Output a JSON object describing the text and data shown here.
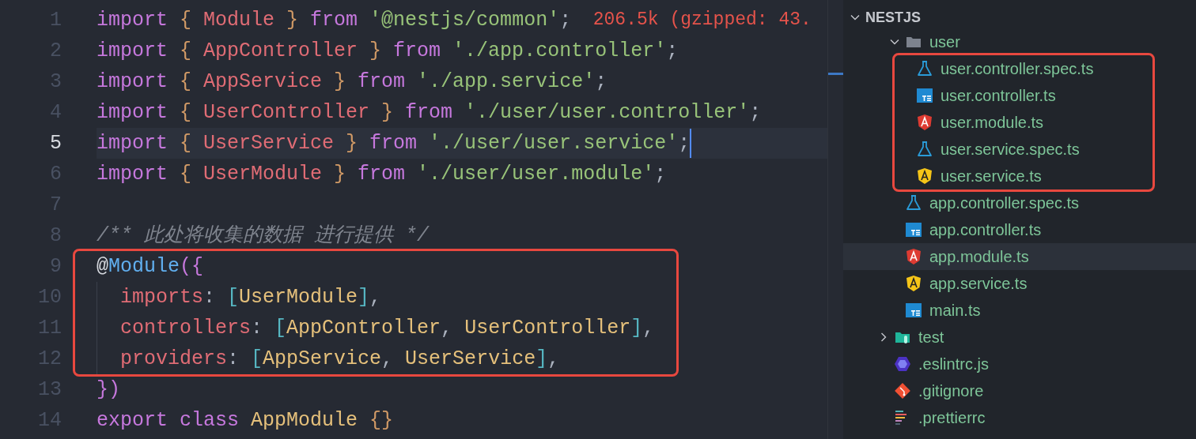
{
  "editor": {
    "lines": [
      {
        "number": "1",
        "current": false,
        "boxed": false,
        "indented": false,
        "tokens": [
          {
            "text": "import",
            "kind": "keyword"
          },
          {
            "text": " {",
            "kind": "brace"
          },
          {
            "text": " Module",
            "kind": "ident"
          },
          {
            "text": " }",
            "kind": "brace"
          },
          {
            "text": " from",
            "kind": "keyword"
          },
          {
            "text": " '@nestjs/common'",
            "kind": "string"
          },
          {
            "text": ";",
            "kind": "punct"
          },
          {
            "text": "  206.5k (gzipped: 43.",
            "kind": "hint"
          }
        ]
      },
      {
        "number": "2",
        "current": false,
        "boxed": false,
        "indented": false,
        "tokens": [
          {
            "text": "import",
            "kind": "keyword"
          },
          {
            "text": " {",
            "kind": "brace"
          },
          {
            "text": " AppController",
            "kind": "ident"
          },
          {
            "text": " }",
            "kind": "brace"
          },
          {
            "text": " from",
            "kind": "keyword"
          },
          {
            "text": " './app.controller'",
            "kind": "string"
          },
          {
            "text": ";",
            "kind": "punct"
          }
        ]
      },
      {
        "number": "3",
        "current": false,
        "boxed": false,
        "indented": false,
        "tokens": [
          {
            "text": "import",
            "kind": "keyword"
          },
          {
            "text": " {",
            "kind": "brace"
          },
          {
            "text": " AppService",
            "kind": "ident"
          },
          {
            "text": " }",
            "kind": "brace"
          },
          {
            "text": " from",
            "kind": "keyword"
          },
          {
            "text": " './app.service'",
            "kind": "string"
          },
          {
            "text": ";",
            "kind": "punct"
          }
        ]
      },
      {
        "number": "4",
        "current": false,
        "boxed": false,
        "indented": false,
        "tokens": [
          {
            "text": "import",
            "kind": "keyword"
          },
          {
            "text": " {",
            "kind": "brace"
          },
          {
            "text": " UserController",
            "kind": "ident"
          },
          {
            "text": " }",
            "kind": "brace"
          },
          {
            "text": " from",
            "kind": "keyword"
          },
          {
            "text": " './user/user.controller'",
            "kind": "string"
          },
          {
            "text": ";",
            "kind": "punct"
          }
        ]
      },
      {
        "number": "5",
        "current": true,
        "boxed": false,
        "indented": false,
        "tokens": [
          {
            "text": "import",
            "kind": "keyword"
          },
          {
            "text": " {",
            "kind": "brace"
          },
          {
            "text": " UserService",
            "kind": "ident"
          },
          {
            "text": " }",
            "kind": "brace"
          },
          {
            "text": " from",
            "kind": "keyword"
          },
          {
            "text": " './user/user.service'",
            "kind": "string"
          },
          {
            "text": ";",
            "kind": "punct"
          }
        ]
      },
      {
        "number": "6",
        "current": false,
        "boxed": false,
        "indented": false,
        "tokens": [
          {
            "text": "import",
            "kind": "keyword"
          },
          {
            "text": " {",
            "kind": "brace"
          },
          {
            "text": " UserModule",
            "kind": "ident"
          },
          {
            "text": " }",
            "kind": "brace"
          },
          {
            "text": " from",
            "kind": "keyword"
          },
          {
            "text": " './user/user.module'",
            "kind": "string"
          },
          {
            "text": ";",
            "kind": "punct"
          }
        ]
      },
      {
        "number": "7",
        "current": false,
        "boxed": false,
        "indented": false
      },
      {
        "number": "8",
        "current": false,
        "boxed": false,
        "indented": false,
        "tokens": [
          {
            "text": "/** 此处将收集的数据 进行提供 */",
            "kind": "comment"
          }
        ]
      },
      {
        "number": "9",
        "current": false,
        "boxed": true,
        "indented": false,
        "tokens": [
          {
            "text": "@",
            "kind": "at"
          },
          {
            "text": "Module",
            "kind": "decorator"
          },
          {
            "text": "({",
            "kind": "paren"
          }
        ]
      },
      {
        "number": "10",
        "current": false,
        "boxed": true,
        "indented": true,
        "tokens": [
          {
            "text": "imports",
            "kind": "ident"
          },
          {
            "text": ":",
            "kind": "punct"
          },
          {
            "text": " [",
            "kind": "bracket"
          },
          {
            "text": "UserModule",
            "kind": "class"
          },
          {
            "text": "]",
            "kind": "bracket"
          },
          {
            "text": ",",
            "kind": "punct"
          }
        ]
      },
      {
        "number": "11",
        "current": false,
        "boxed": true,
        "indented": true,
        "tokens": [
          {
            "text": "controllers",
            "kind": "ident"
          },
          {
            "text": ":",
            "kind": "punct"
          },
          {
            "text": " [",
            "kind": "bracket"
          },
          {
            "text": "AppController",
            "kind": "class"
          },
          {
            "text": ",",
            "kind": "punct"
          },
          {
            "text": " UserController",
            "kind": "class"
          },
          {
            "text": "]",
            "kind": "bracket"
          },
          {
            "text": ",",
            "kind": "punct"
          }
        ]
      },
      {
        "number": "12",
        "current": false,
        "boxed": true,
        "indented": true,
        "tokens": [
          {
            "text": "providers",
            "kind": "ident"
          },
          {
            "text": ":",
            "kind": "punct"
          },
          {
            "text": " [",
            "kind": "bracket"
          },
          {
            "text": "AppService",
            "kind": "class"
          },
          {
            "text": ",",
            "kind": "punct"
          },
          {
            "text": " UserService",
            "kind": "class"
          },
          {
            "text": "]",
            "kind": "bracket"
          },
          {
            "text": ",",
            "kind": "punct"
          }
        ]
      },
      {
        "number": "13",
        "current": false,
        "boxed": false,
        "indented": false,
        "tokens": [
          {
            "text": "})",
            "kind": "paren"
          }
        ]
      },
      {
        "number": "14",
        "current": false,
        "boxed": false,
        "indented": false,
        "tokens": [
          {
            "text": "export",
            "kind": "keyword"
          },
          {
            "text": " class",
            "kind": "keyword"
          },
          {
            "text": " AppModule",
            "kind": "class"
          },
          {
            "text": " {}",
            "kind": "brace"
          }
        ]
      }
    ]
  },
  "explorer": {
    "title": "NESTJS",
    "expanded": true,
    "tree": [
      {
        "children": [
          {
            "name": "user",
            "kind": "folder",
            "expanded": true,
            "selected": false,
            "boxed": false,
            "children": [
              {
                "name": "user.controller.spec.ts",
                "kind": "test",
                "selected": false,
                "boxed": true
              },
              {
                "name": "user.controller.ts",
                "kind": "ts",
                "selected": false,
                "boxed": true
              },
              {
                "name": "user.module.ts",
                "kind": "module",
                "selected": false,
                "boxed": true
              },
              {
                "name": "user.service.spec.ts",
                "kind": "test",
                "selected": false,
                "boxed": true
              },
              {
                "name": "user.service.ts",
                "kind": "service",
                "selected": false,
                "boxed": true
              }
            ]
          },
          {
            "name": "app.controller.spec.ts",
            "kind": "test",
            "selected": false,
            "boxed": false
          },
          {
            "name": "app.controller.ts",
            "kind": "ts",
            "selected": false,
            "boxed": false
          },
          {
            "name": "app.module.ts",
            "kind": "module",
            "selected": true,
            "boxed": false
          },
          {
            "name": "app.service.ts",
            "kind": "service",
            "selected": false,
            "boxed": false
          },
          {
            "name": "main.ts",
            "kind": "ts",
            "selected": false,
            "boxed": false
          }
        ]
      },
      {
        "name": "test",
        "kind": "test-folder",
        "expanded": false,
        "selected": false,
        "boxed": false
      },
      {
        "name": ".eslintrc.js",
        "kind": "eslint",
        "selected": false,
        "boxed": false
      },
      {
        "name": ".gitignore",
        "kind": "git",
        "selected": false,
        "boxed": false
      },
      {
        "name": ".prettierrc",
        "kind": "prettier",
        "selected": false,
        "boxed": false
      }
    ]
  }
}
